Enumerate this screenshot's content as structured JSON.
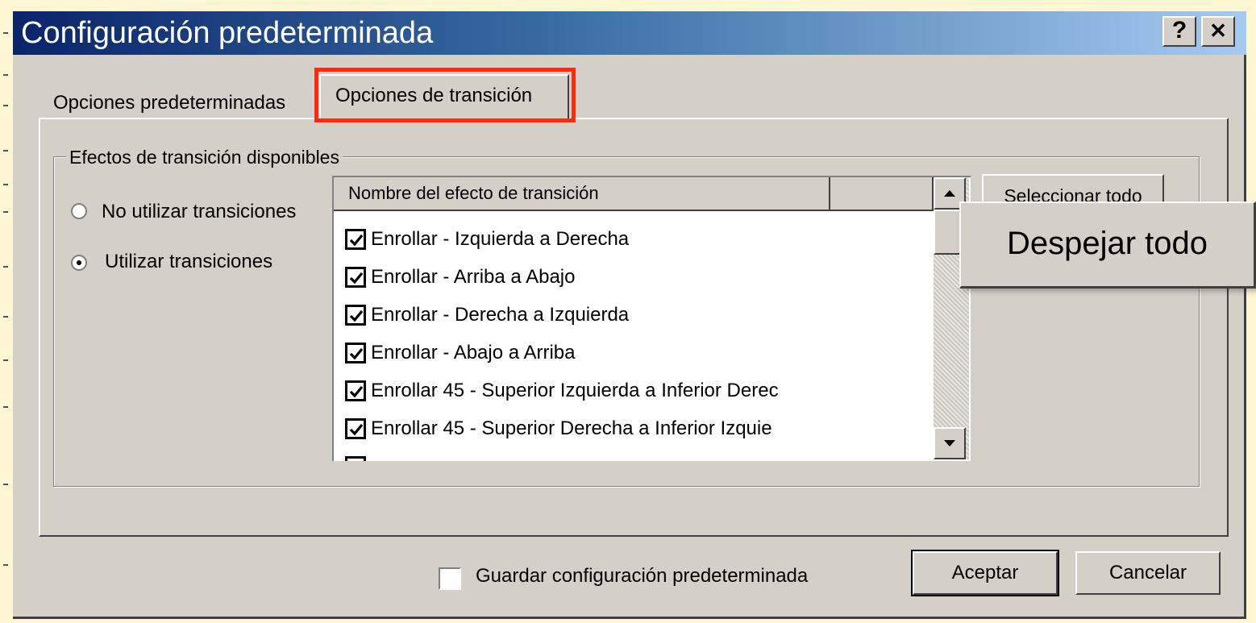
{
  "window": {
    "title": "Configuración predeterminada",
    "help_label": "?",
    "close_label": "✕"
  },
  "tabs": [
    {
      "label": "Opciones predeterminadas",
      "selected": false
    },
    {
      "label": "Opciones de transición",
      "selected": true
    }
  ],
  "group": {
    "label": "Efectos de transición disponibles",
    "radios": [
      {
        "label": "No utilizar transiciones",
        "checked": false
      },
      {
        "label": "Utilizar transiciones",
        "checked": true
      }
    ]
  },
  "list": {
    "column_header": "Nombre del efecto de transición",
    "items": [
      {
        "label": "Enrollar - Izquierda a Derecha",
        "checked": true
      },
      {
        "label": "Enrollar - Arriba a Abajo",
        "checked": true
      },
      {
        "label": "Enrollar - Derecha a Izquierda",
        "checked": true
      },
      {
        "label": "Enrollar - Abajo a Arriba",
        "checked": true
      },
      {
        "label": "Enrollar 45 - Superior Izquierda a Inferior Derec",
        "checked": true
      },
      {
        "label": "Enrollar 45 - Superior Derecha a  Inferior Izquie",
        "checked": true
      }
    ]
  },
  "buttons": {
    "select_all": "Seleccionar todo",
    "clear_all": "Despejar todo",
    "accept": "Aceptar",
    "cancel": "Cancelar"
  },
  "footer": {
    "save_default_label": "Guardar configuración predeterminada",
    "save_default_checked": false
  },
  "colors": {
    "titlebar_start": "#0a246a",
    "titlebar_end": "#a6caf0",
    "dialog_face": "#d4d0c8",
    "highlight": "#ff2a0a",
    "slide_background": "#fdf7d4"
  }
}
